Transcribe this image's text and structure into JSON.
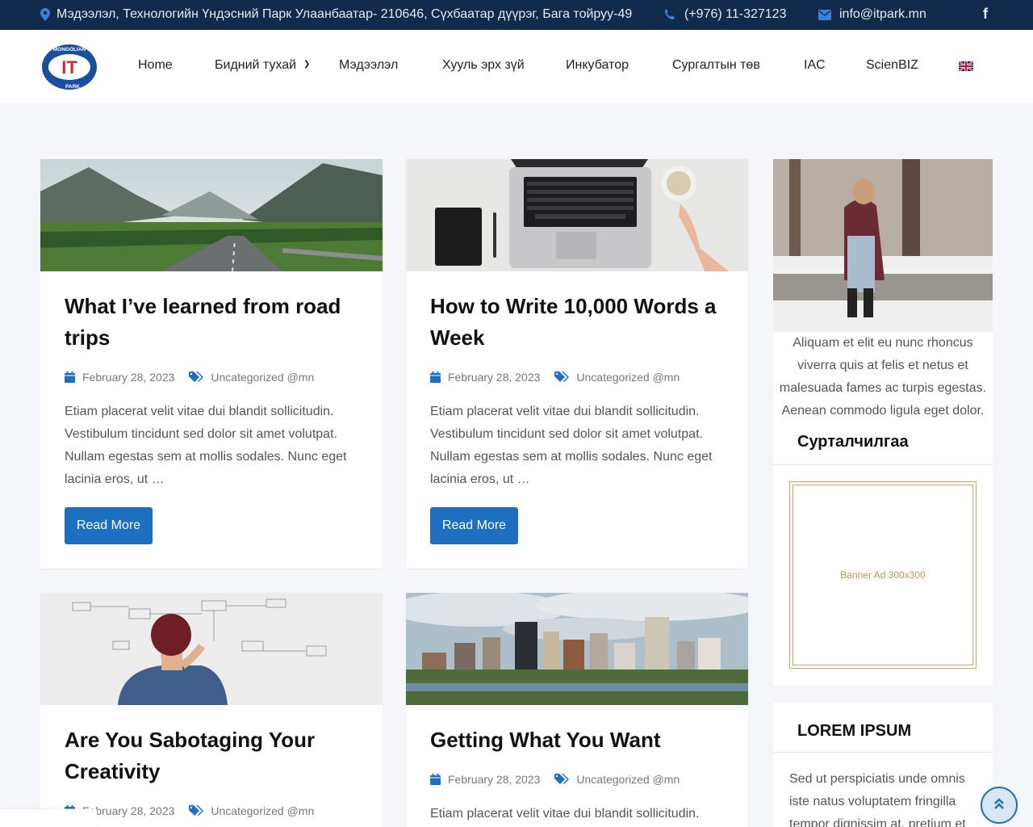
{
  "topbar": {
    "address": "Мэдээлэл, Технологийн Үндэсний Парк Улаанбаатар- 210646, Сүхбаатар дүүрэг, Бага тойруу-49",
    "phone": "(+976) 11-327123",
    "email": "info@itpark.mn",
    "social_icon": "facebook-icon"
  },
  "logo": {
    "main": "IT",
    "top_text": "MONGOLIAN",
    "bottom_text": "PARK"
  },
  "nav": {
    "items": [
      "Home",
      "Бидний тухай",
      "Мэдээлэл",
      "Хууль эрх зүй",
      "Инкубатор",
      "Сургалтын төв",
      "IAC",
      "ScienBIZ"
    ],
    "language_icon": "uk-flag-icon"
  },
  "posts": [
    {
      "title": "What I’ve learned from road trips",
      "date": "February 28, 2023",
      "category": "Uncategorized @mn",
      "excerpt": "Etiam placerat velit vitae dui blandit sollicitudin. Vestibulum tincidunt sed dolor sit amet volutpat. Nullam egestas sem at mollis sodales. Nunc eget lacinia eros, ut …",
      "button": "Read More"
    },
    {
      "title": "How to Write 10,000 Words a Week",
      "date": "February 28, 2023",
      "category": "Uncategorized @mn",
      "excerpt": "Etiam placerat velit vitae dui blandit sollicitudin. Vestibulum tincidunt sed dolor sit amet volutpat. Nullam egestas sem at mollis sodales. Nunc eget lacinia eros, ut …",
      "button": "Read More"
    },
    {
      "title": "Are You Sabotaging Your Creativity",
      "date": "February 28, 2023",
      "category": "Uncategorized @mn"
    },
    {
      "title": "Getting What You Want",
      "date": "February 28, 2023",
      "category": "Uncategorized @mn",
      "excerpt": "Etiam placerat velit vitae dui blandit sollicitudin."
    }
  ],
  "sidebar": {
    "caption": "Aliquam et elit eu nunc rhoncus viverra quis at felis et netus et malesuada fames ac turpis egestas. Aenean commodo ligula eget dolor.",
    "ads_title": "Сурталчилгаа",
    "ad_text": "Banner Ad 300x300",
    "lorem_title": "LOREM IPSUM",
    "lorem_text": "Sed ut perspiciatis unde omnis iste natus voluptatem fringilla tempor dignissim at, pretium et"
  },
  "colors": {
    "primary": "#1e6fc0",
    "topbar": "#0f2a4a",
    "gold": "#c9a46a"
  }
}
